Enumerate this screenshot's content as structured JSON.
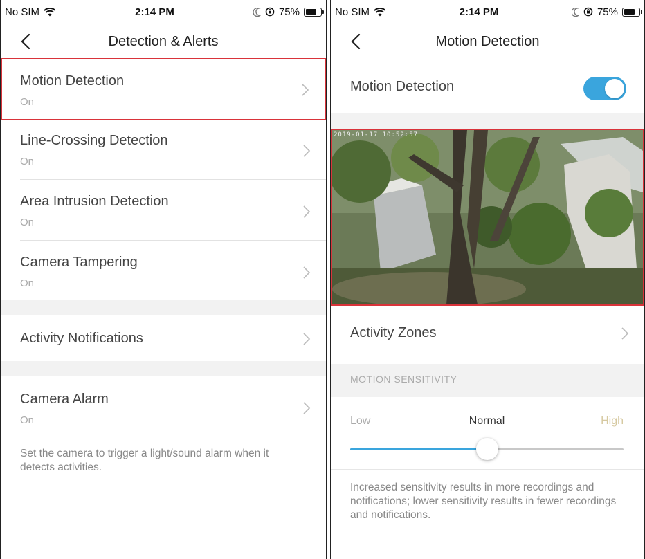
{
  "left": {
    "status": {
      "carrier": "No SIM",
      "time": "2:14 PM",
      "battery": "75%",
      "battery_level": 0.75
    },
    "nav": {
      "title": "Detection & Alerts"
    },
    "rows": [
      {
        "label": "Motion Detection",
        "value": "On"
      },
      {
        "label": "Line-Crossing Detection",
        "value": "On"
      },
      {
        "label": "Area Intrusion Detection",
        "value": "On"
      },
      {
        "label": "Camera Tampering",
        "value": "On"
      }
    ],
    "activity_notifications": {
      "label": "Activity Notifications"
    },
    "camera_alarm": {
      "label": "Camera Alarm",
      "value": "On"
    },
    "alarm_note": "Set the camera to trigger a light/sound alarm when it detects activities."
  },
  "right": {
    "status": {
      "carrier": "No SIM",
      "time": "2:14 PM",
      "battery": "75%",
      "battery_level": 0.75
    },
    "nav": {
      "title": "Motion Detection"
    },
    "motion_toggle": {
      "label": "Motion Detection",
      "on": true
    },
    "camera": {
      "timestamp": "2019-01-17 10:52:57"
    },
    "activity_zones": {
      "label": "Activity Zones"
    },
    "sensitivity": {
      "header": "MOTION SENSITIVITY",
      "low": "Low",
      "normal": "Normal",
      "high": "High",
      "level": 0.5
    },
    "sensitivity_note": "Increased sensitivity results in more recordings and notifications; lower sensitivity results in fewer recordings and notifications."
  },
  "colors": {
    "accent": "#3aa5dd",
    "highlight_border": "#d9333a",
    "section_bg": "#f2f2f2",
    "muted_text": "#aaaaaa"
  }
}
